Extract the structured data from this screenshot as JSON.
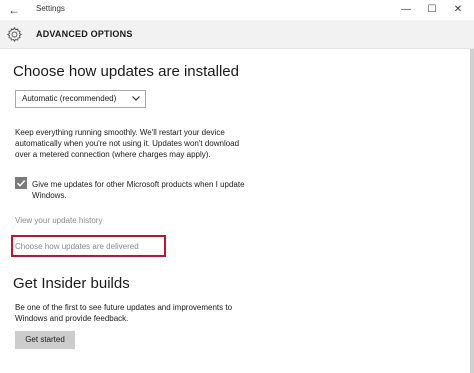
{
  "window": {
    "title": "Settings",
    "back_glyph": "←",
    "minimize_glyph": "—",
    "maximize_glyph": "☐",
    "close_glyph": "✕"
  },
  "header": {
    "title": "ADVANCED OPTIONS",
    "icon": "gear-icon"
  },
  "install": {
    "heading": "Choose how updates are installed",
    "dropdown_value": "Automatic (recommended)",
    "description_line1": "Keep everything running smoothly. We'll restart your device",
    "description_line2": "automatically when you're not using it. Updates won't download",
    "description_line3": "over a metered connection (where charges may apply).",
    "checkbox_checked": true,
    "checkbox_label_line1": "Give me updates for other Microsoft products when I update",
    "checkbox_label_line2": "Windows.",
    "link_history": "View your update history",
    "link_delivered": "Choose how updates are delivered"
  },
  "insider": {
    "heading": "Get Insider builds",
    "description_line1": "Be one of the first to see future updates and improvements to",
    "description_line2": "Windows and provide feedback.",
    "button_label": "Get started"
  },
  "colors": {
    "highlight": "#c8102e",
    "link": "#8a8a8a",
    "header_bg": "#f2f2f2"
  }
}
